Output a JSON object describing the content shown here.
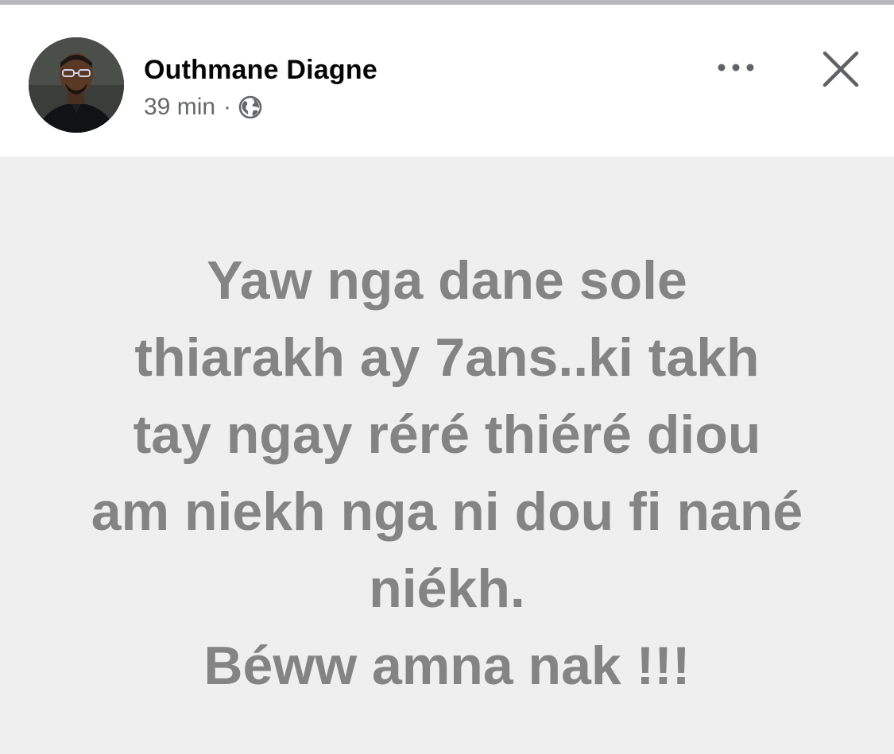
{
  "post": {
    "author": "Outhmane Diagne",
    "time": "39 min",
    "separator": "·",
    "audience_icon": "globe-icon",
    "more_icon": "more-horizontal-icon",
    "close_icon": "close-icon",
    "body_lines": [
      "Yaw nga dane sole",
      "thiarakh ay 7ans..ki takh",
      "tay ngay réré thiéré diou",
      "am niekh nga ni dou fi nané",
      "niékh.",
      "Béww amna nak !!!"
    ]
  },
  "colors": {
    "background_text_post": "#efefef",
    "post_text": "#848484",
    "author_name": "#050505",
    "meta_text": "#65676b"
  }
}
